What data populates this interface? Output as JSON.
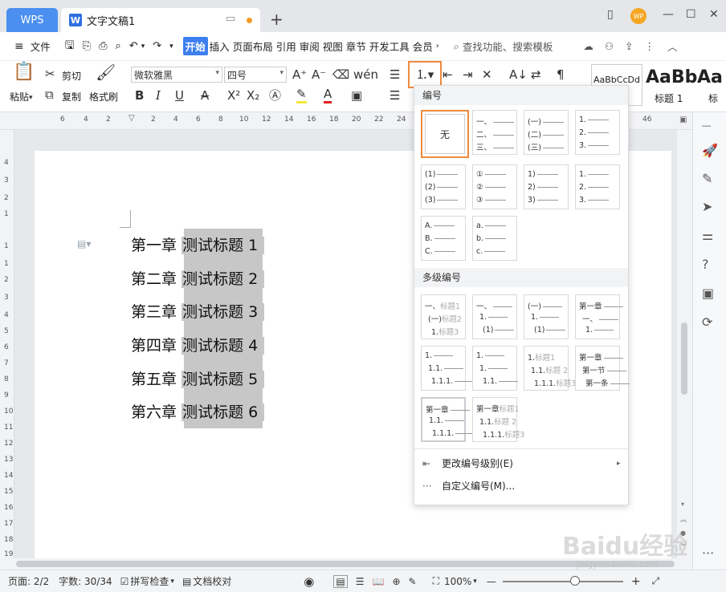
{
  "titlebar": {
    "app_tab": "WPS",
    "doc_tab": "文字文稿1",
    "doc_icon": "W",
    "new_tab": "+",
    "avatar": "WP"
  },
  "menubar": {
    "file": "文件",
    "items": [
      "开始",
      "插入",
      "页面布局",
      "引用",
      "审阅",
      "视图",
      "章节",
      "开发工具",
      "会员"
    ],
    "search_placeholder": "查找功能、搜索模板"
  },
  "ribbon": {
    "paste": "粘贴",
    "cut": "剪切",
    "copy": "复制",
    "format_painter": "格式刷",
    "font_name": "微软雅黑",
    "font_size": "四号",
    "style_preview_normal": "AaBbCcDd",
    "style_preview_heading": "AaBb",
    "style_preview_heading2": "Aa",
    "style_label_heading": "标题 1",
    "style_label_partial": "标"
  },
  "ruler": {
    "h_ticks": [
      "6",
      "4",
      "2",
      "2",
      "4",
      "6",
      "8",
      "10",
      "12",
      "14",
      "16",
      "18",
      "20",
      "22",
      "24",
      "46"
    ],
    "v_ticks": [
      "4",
      "3",
      "2",
      "1",
      "1",
      "1",
      "2",
      "3",
      "4",
      "5",
      "6",
      "7",
      "8",
      "9",
      "10",
      "11",
      "12",
      "13",
      "14",
      "15",
      "16",
      "17",
      "18",
      "19"
    ]
  },
  "document": {
    "lines": [
      {
        "chapter": "第一章",
        "title": "测试标题 1"
      },
      {
        "chapter": "第二章",
        "title": "测试标题 2"
      },
      {
        "chapter": "第三章",
        "title": "测试标题 3"
      },
      {
        "chapter": "第四章",
        "title": "测试标题 4"
      },
      {
        "chapter": "第五章",
        "title": "测试标题 5"
      },
      {
        "chapter": "第六章",
        "title": "测试标题 6"
      }
    ]
  },
  "dropdown": {
    "section_numbering": "编号",
    "none_label": "无",
    "section_multilevel": "多级编号",
    "menu_change_level": "更改编号级别(E)",
    "menu_custom": "自定义编号(M)...",
    "single": [
      [
        "一、",
        "二、",
        "三、"
      ],
      [
        "(一)",
        "(二)",
        "(三)"
      ],
      [
        "1.",
        "2.",
        "3."
      ],
      [
        "(1)",
        "(2)",
        "(3)"
      ],
      [
        "①",
        "②",
        "③"
      ],
      [
        "1)",
        "2)",
        "3)"
      ],
      [
        "1.",
        "2.",
        "3."
      ],
      [
        "A.",
        "B.",
        "C."
      ],
      [
        "a.",
        "b.",
        "c."
      ]
    ],
    "multi": [
      [
        [
          "一、",
          "标题1"
        ],
        [
          "(一)",
          "标题2"
        ],
        [
          "1.",
          "标题3"
        ]
      ],
      [
        [
          "一、",
          ""
        ],
        [
          "1.",
          ""
        ],
        [
          "(1)",
          ""
        ]
      ],
      [
        [
          "(一)",
          ""
        ],
        [
          "1.",
          ""
        ],
        [
          "(1)",
          ""
        ]
      ],
      [
        [
          "第一章",
          ""
        ],
        [
          "一、",
          ""
        ],
        [
          "1.",
          ""
        ]
      ],
      [
        [
          "1.",
          ""
        ],
        [
          "1.1.",
          ""
        ],
        [
          "1.1.1.",
          ""
        ]
      ],
      [
        [
          "1.",
          ""
        ],
        [
          "1.",
          ""
        ],
        [
          "1.1.",
          ""
        ]
      ],
      [
        [
          "1.",
          "标题1"
        ],
        [
          "1.1.",
          "标题 2"
        ],
        [
          "1.1.1.",
          "标题3"
        ]
      ],
      [
        [
          "第一章",
          ""
        ],
        [
          "第一节",
          ""
        ],
        [
          "第一条",
          ""
        ]
      ],
      [
        [
          "第一章",
          ""
        ],
        [
          "1.1.",
          ""
        ],
        [
          "1.1.1.",
          ""
        ]
      ],
      [
        [
          "第一章",
          "标题1"
        ],
        [
          "1.1.",
          "标题 2"
        ],
        [
          "1.1.1.",
          "标题3"
        ]
      ]
    ]
  },
  "statusbar": {
    "page": "页面: 2/2",
    "words": "字数: 30/34",
    "spell": "拼写检查",
    "proof": "文档校对",
    "zoom": "100%"
  },
  "watermark": {
    "text": "Baidu经验",
    "sub": "jingyan.baidu.com"
  }
}
